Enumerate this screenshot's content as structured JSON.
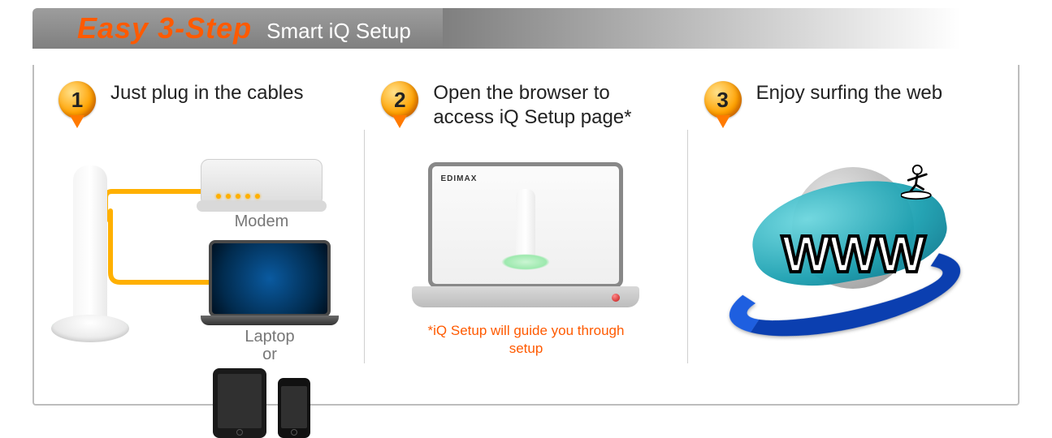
{
  "banner": {
    "title": "Easy 3-Step",
    "subtitle": "Smart iQ Setup"
  },
  "steps": [
    {
      "num": "1",
      "title": "Just plug  in the cables",
      "labels": {
        "modem": "Modem",
        "laptop": "Laptop\nor"
      }
    },
    {
      "num": "2",
      "title": "Open the browser to access iQ Setup page*",
      "brand": "EDIMAX",
      "footnote": "*iQ Setup will guide you through setup"
    },
    {
      "num": "3",
      "title": "Enjoy surfing the web",
      "www": "WWW"
    }
  ],
  "colors": {
    "accent": "#ff5a00",
    "cable": "#ffb000"
  }
}
